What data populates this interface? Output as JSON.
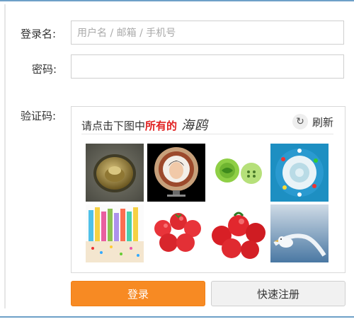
{
  "form": {
    "username_label": "登录名:",
    "username_placeholder": "用户名 / 邮箱 / 手机号",
    "password_label": "密码:",
    "captcha_label": "验证码:"
  },
  "captcha": {
    "prompt_prefix": "请点击下图中",
    "prompt_highlight": "所有的",
    "target_word": "海鸥",
    "refresh_label": "刷新",
    "tiles": [
      "golden-ingot",
      "portrait-plate",
      "green-buttons",
      "blue-plate",
      "birthday-candles",
      "cherry-tomatoes",
      "red-tomatoes",
      "seagull"
    ]
  },
  "actions": {
    "login_label": "登录",
    "register_label": "快速注册"
  },
  "colors": {
    "accent": "#f78a23",
    "highlight": "#e02020",
    "border": "#cfcfcf",
    "frame": "#6ea0c8"
  },
  "icons": {
    "refresh": "refresh-icon"
  }
}
